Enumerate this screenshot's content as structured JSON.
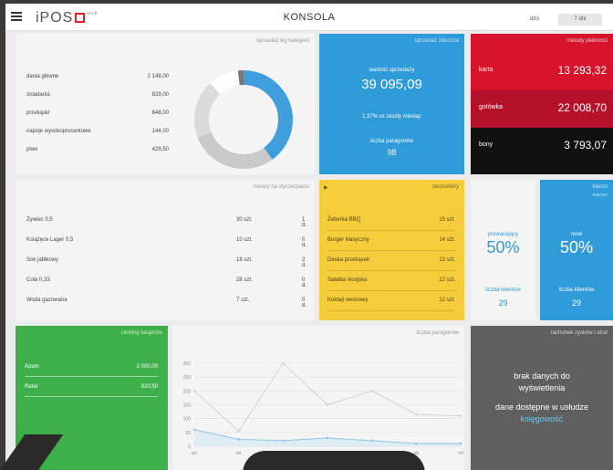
{
  "header": {
    "logo_text": "iPOS",
    "logo_sup": "web",
    "title": "KONSOLA",
    "range_today": "dziś",
    "range_week": "7 dni"
  },
  "categories": {
    "title": "sprzedaż wg kategorii",
    "rows": [
      {
        "name": "dania główne",
        "value": "2 148,00"
      },
      {
        "name": "śniadania",
        "value": "829,00"
      },
      {
        "name": "przekąski",
        "value": "648,00"
      },
      {
        "name": "napoje wysokoprocentowe",
        "value": "144,00"
      },
      {
        "name": "piwo",
        "value": "429,50"
      }
    ],
    "donut_colors": [
      "#3f9fdc",
      "#c9c9c9",
      "#dadada",
      "#ffffff",
      "#777777"
    ],
    "donut_shares": [
      0.4,
      0.29,
      0.19,
      0.1,
      0.02
    ]
  },
  "sales": {
    "title": "sprzedaż zbiorcza",
    "value_label": "wartość sprzedaży",
    "value": "39 095,09",
    "compare": "1,37% vs zeszły miesiąc",
    "receipts_label": "liczba paragonów",
    "receipts": "98"
  },
  "payments": {
    "title": "metody płatności",
    "rows": [
      {
        "name": "karta",
        "value": "13 293,32",
        "color": "#d7132c"
      },
      {
        "name": "gotówka",
        "value": "22 008,70",
        "color": "#b5112a"
      },
      {
        "name": "bony",
        "value": "3 793,07",
        "color": "#111111"
      }
    ]
  },
  "products": {
    "title": "towary na wyczerpaniu",
    "rows": [
      {
        "name": "Żywiec 0,5",
        "qty": "30 szt.",
        "days": "1 d."
      },
      {
        "name": "Książęce Lager 0,5",
        "qty": "10 szt.",
        "days": "0 d."
      },
      {
        "name": "Sok jabłkowy",
        "qty": "18 szt.",
        "days": "2 d."
      },
      {
        "name": "Cola 0,33",
        "qty": "28 szt.",
        "days": "0 d."
      },
      {
        "name": "Woda gazowana",
        "qty": "7 szt.",
        "days": "0 d."
      }
    ]
  },
  "bestsellers": {
    "title": "bestsellery",
    "rows": [
      {
        "name": "Żeberka BBQ",
        "qty": "15 szt."
      },
      {
        "name": "Burger klasyczny",
        "qty": "14 szt."
      },
      {
        "name": "Deska przekąsek",
        "qty": "13 szt."
      },
      {
        "name": "Sałatka nicejska",
        "qty": "12 szt."
      },
      {
        "name": "Koktajl owocowy",
        "qty": "12 szt."
      }
    ]
  },
  "clients": {
    "title": "klienci",
    "subtitle": "marzec",
    "returning_label": "powracający",
    "returning_pct": "50%",
    "returning_count_label": "liczba klientów",
    "returning_count": "29",
    "new_label": "nowi",
    "new_pct": "50%",
    "new_count_label": "liczba klientów",
    "new_count": "29"
  },
  "cashiers": {
    "title": "ranking kasjerów",
    "rows": [
      {
        "name": "Adam",
        "value": "2 000,00"
      },
      {
        "name": "Rafał",
        "value": "820,50"
      }
    ]
  },
  "receipts_chart": {
    "title": "liczba paragonów"
  },
  "chart_data": {
    "type": "line",
    "title": "liczba paragonów",
    "categories": [
      "pn",
      "wt",
      "śr",
      "czw",
      "pt",
      "sb",
      "nd"
    ],
    "ylim": [
      0,
      300
    ],
    "yticks": [
      "0",
      "50",
      "100",
      "150",
      "200",
      "250",
      "300"
    ],
    "series": [
      {
        "values": [
          200,
          55,
          300,
          150,
          200,
          115,
          110
        ],
        "color": "#d3d3d3"
      },
      {
        "values": [
          60,
          25,
          20,
          30,
          20,
          10,
          10
        ],
        "color": "#8fc7e6"
      }
    ],
    "grid": true
  },
  "profit": {
    "title": "rachunek zysków i strat",
    "msg1": "brak danych do",
    "msg2": "wyświetlenia",
    "msg3": "dane dostępne w usłudze",
    "link": "księgowość"
  }
}
